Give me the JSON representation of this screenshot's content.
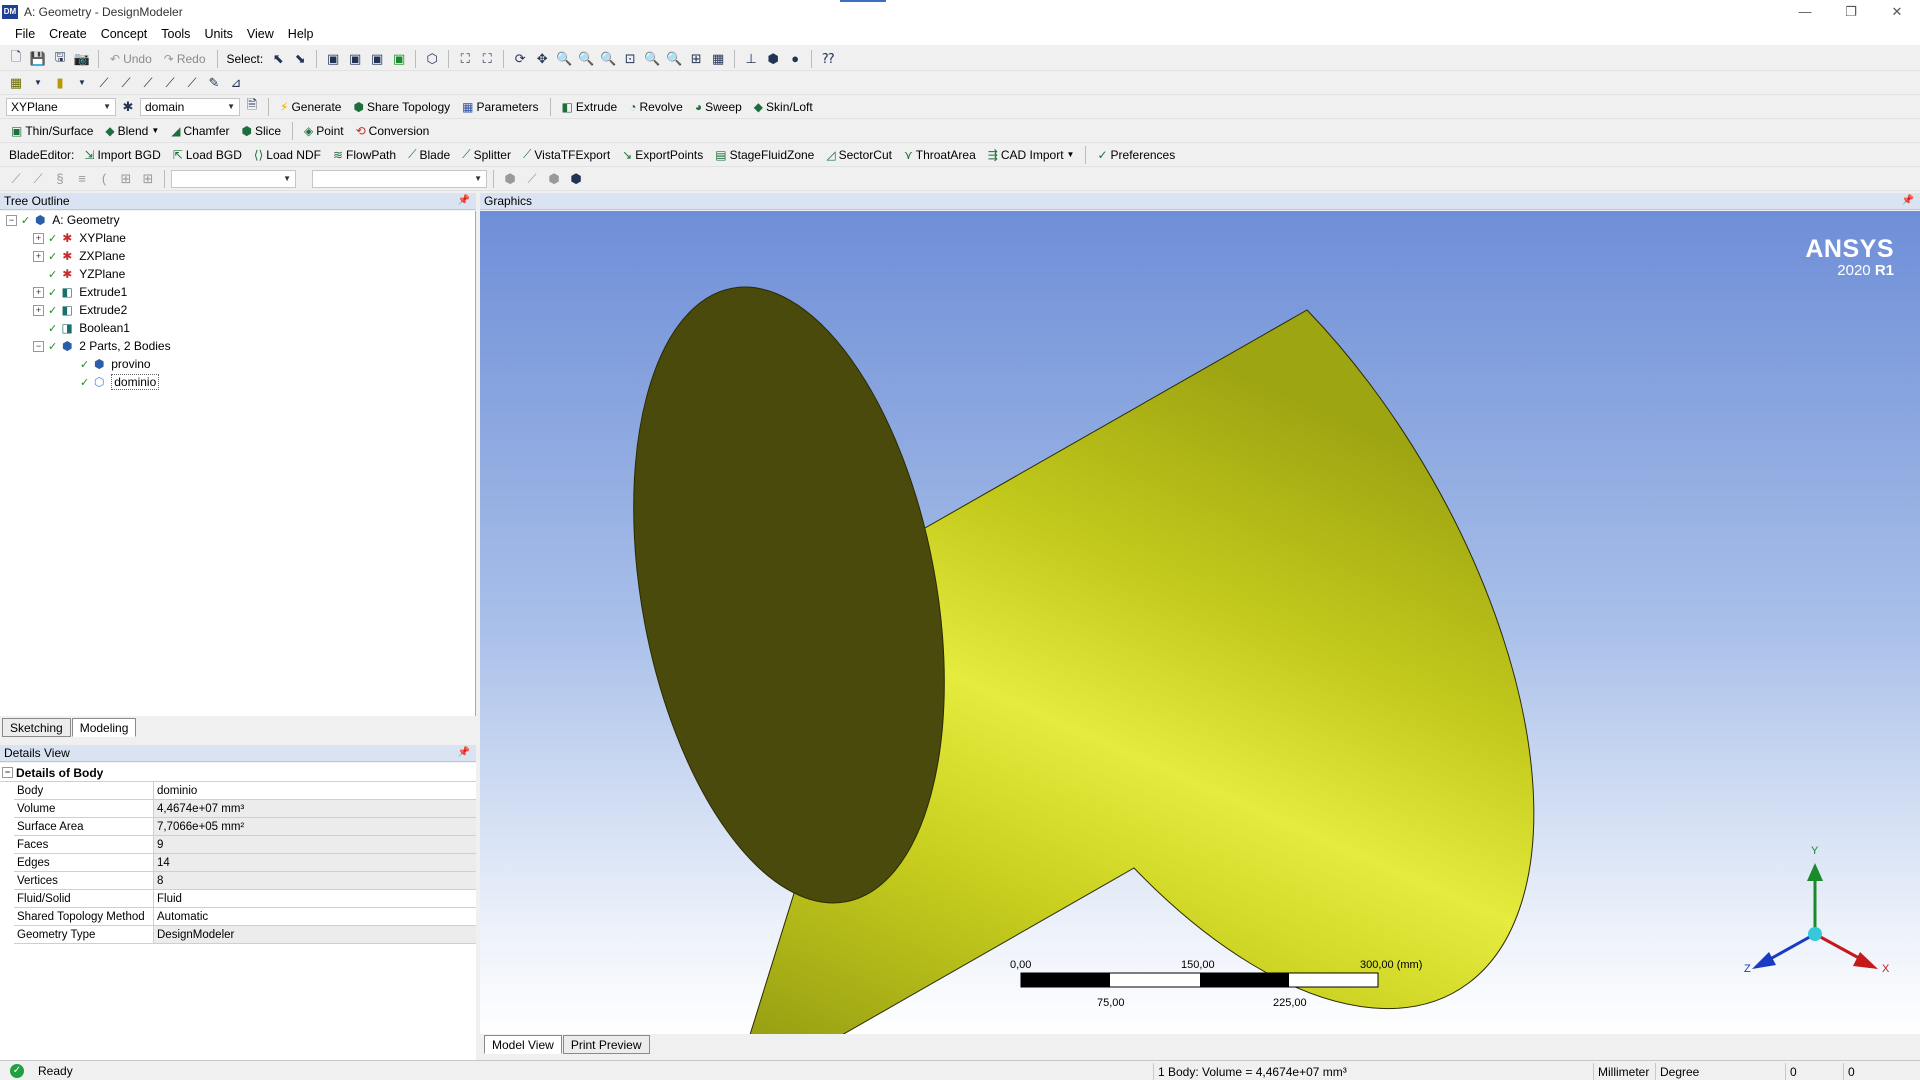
{
  "window": {
    "title": "A: Geometry - DesignModeler",
    "logo": "DM",
    "controls": {
      "minimize": "—",
      "restore": "❐",
      "close": "✕"
    }
  },
  "menu": [
    "File",
    "Create",
    "Concept",
    "Tools",
    "Units",
    "View",
    "Help"
  ],
  "toolbar1": {
    "undo": "Undo",
    "redo": "Redo",
    "select_label": "Select:"
  },
  "toolbar3": {
    "plane": "XYPlane",
    "sketch": "domain",
    "generate": "Generate",
    "share_topology": "Share Topology",
    "parameters": "Parameters",
    "extrude": "Extrude",
    "revolve": "Revolve",
    "sweep": "Sweep",
    "skin_loft": "Skin/Loft"
  },
  "toolbar4": {
    "thin_surface": "Thin/Surface",
    "blend": "Blend",
    "chamfer": "Chamfer",
    "slice": "Slice",
    "point": "Point",
    "conversion": "Conversion"
  },
  "toolbar5": {
    "blade_editor": "BladeEditor:",
    "import_bgd": "Import BGD",
    "load_bgd": "Load BGD",
    "load_ndf": "Load NDF",
    "flowpath": "FlowPath",
    "blade": "Blade",
    "splitter": "Splitter",
    "vistatf_export": "VistaTFExport",
    "export_points": "ExportPoints",
    "stage_fluid_zone": "StageFluidZone",
    "sector_cut": "SectorCut",
    "throat_area": "ThroatArea",
    "cad_import": "CAD Import",
    "preferences": "Preferences"
  },
  "tree": {
    "header": "Tree Outline",
    "nodes": [
      {
        "label": "A: Geometry"
      },
      {
        "label": "XYPlane"
      },
      {
        "label": "ZXPlane"
      },
      {
        "label": "YZPlane"
      },
      {
        "label": "Extrude1"
      },
      {
        "label": "Extrude2"
      },
      {
        "label": "Boolean1"
      },
      {
        "label": "2 Parts, 2 Bodies"
      },
      {
        "label": "provino"
      },
      {
        "label": "dominio"
      }
    ]
  },
  "left_tabs": {
    "sketching": "Sketching",
    "modeling": "Modeling"
  },
  "details": {
    "header": "Details View",
    "group": "Details of Body",
    "rows": [
      {
        "key": "Body",
        "value": "dominio"
      },
      {
        "key": "Volume",
        "value": "4,4674e+07 mm³"
      },
      {
        "key": "Surface Area",
        "value": "7,7066e+05 mm²"
      },
      {
        "key": "Faces",
        "value": "9"
      },
      {
        "key": "Edges",
        "value": "14"
      },
      {
        "key": "Vertices",
        "value": "8"
      },
      {
        "key": "Fluid/Solid",
        "value": "Fluid"
      },
      {
        "key": "Shared Topology Method",
        "value": "Automatic"
      },
      {
        "key": "Geometry Type",
        "value": "DesignModeler"
      }
    ]
  },
  "graphics": {
    "header": "Graphics",
    "logo_name": "ANSYS",
    "logo_version": "2020",
    "logo_release": "R1",
    "scale": {
      "t0": "0,00",
      "t150": "150,00",
      "t300": "300,00 (mm)",
      "t75": "75,00",
      "t225": "225,00"
    },
    "triad": {
      "x": "X",
      "y": "Y",
      "z": "Z"
    },
    "colors": {
      "body": "#c8cf1e",
      "body_dark": "#4a4a0c"
    }
  },
  "bottom_tabs": {
    "model_view": "Model View",
    "print_preview": "Print Preview"
  },
  "status": {
    "text": "Ready",
    "selection": "1 Body: Volume = 4,4674e+07 mm³",
    "length_unit": "Millimeter",
    "angle_unit": "Degree",
    "c1": "0",
    "c2": "0"
  }
}
